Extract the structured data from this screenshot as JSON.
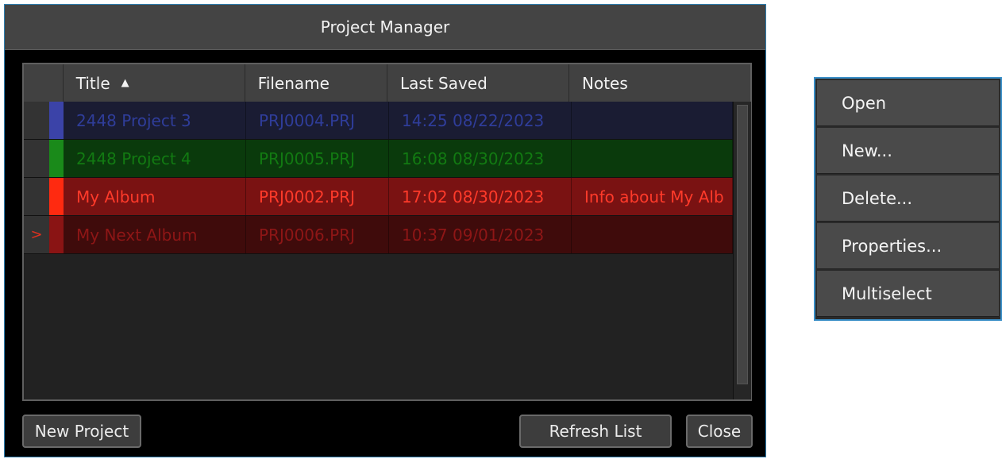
{
  "window": {
    "title": "Project Manager"
  },
  "table": {
    "columns": [
      {
        "label": "",
        "key": "sel"
      },
      {
        "label": "Title",
        "key": "title",
        "sort": "ascending"
      },
      {
        "label": "Filename",
        "key": "file"
      },
      {
        "label": "Last Saved",
        "key": "saved"
      },
      {
        "label": "Notes",
        "key": "notes"
      }
    ],
    "sort_icon": "sort-ascending-triangle",
    "rows": [
      {
        "indicator": "",
        "title": "2448 Project 3",
        "file": "PRJ0004.PRJ",
        "saved": "14:25 08/22/2023",
        "notes": "",
        "tag_color": "#3b43a8",
        "bg": "#1a1c33",
        "text_color": "#2f3d9a"
      },
      {
        "indicator": "",
        "title": "2448 Project 4",
        "file": "PRJ0005.PRJ",
        "saved": "16:08 08/30/2023",
        "notes": "",
        "tag_color": "#1a8a1a",
        "bg": "#0a3a0c",
        "text_color": "#127a12"
      },
      {
        "indicator": "",
        "title": "My Album",
        "file": "PRJ0002.PRJ",
        "saved": "17:02 08/30/2023",
        "notes": "Info about My Alb",
        "tag_color": "#ff2a10",
        "bg": "#7a1212",
        "text_color": "#ff3a2a"
      },
      {
        "indicator": ">",
        "title": "My Next Album",
        "file": "PRJ0006.PRJ",
        "saved": "10:37 09/01/2023",
        "notes": "",
        "tag_color": "#8a1414",
        "bg": "#3f0b0b",
        "text_color": "#8e1616"
      }
    ]
  },
  "buttons": {
    "new_project": "New Project",
    "refresh": "Refresh List",
    "close": "Close"
  },
  "context_menu": {
    "items": [
      "Open",
      "New...",
      "Delete...",
      "Properties...",
      "Multiselect"
    ]
  },
  "colors": {
    "window_border": "#2f7fb0",
    "menu_border": "#3a8fc8",
    "header_bg": "#414141"
  }
}
